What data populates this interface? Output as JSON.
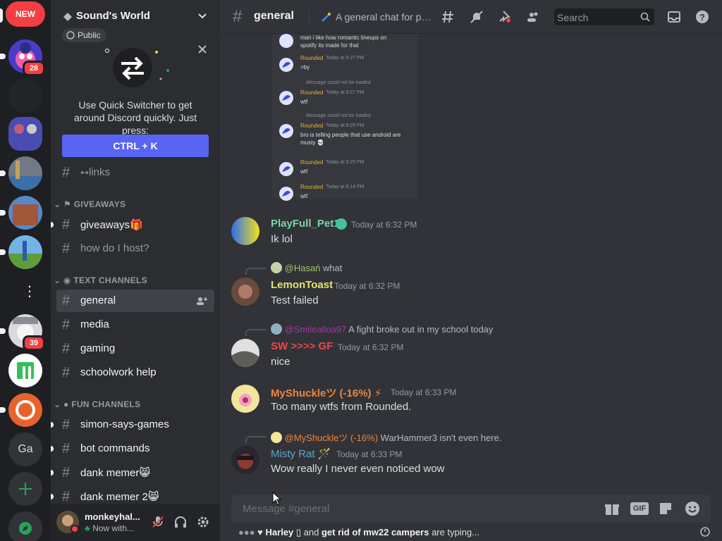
{
  "rail": {
    "new_label": "NEW",
    "badges": {
      "server1": "28",
      "server7": "39"
    },
    "ga_label": "Ga",
    "add_icon": "plus-icon",
    "explore_icon": "compass-icon"
  },
  "server": {
    "name": "Sound's World",
    "public_label": "Public"
  },
  "quick_switcher": {
    "text": "Use Quick Switcher to get around Discord quickly. Just press:",
    "button": "CTRL + K"
  },
  "channels": {
    "links": "⭤links",
    "cat_giveaways": "GIVEAWAYS",
    "giveaways": "giveaways🎁",
    "how_host": "how do I host?",
    "cat_text": "TEXT CHANNELS",
    "general": "general",
    "media": "media",
    "gaming": "gaming",
    "schoolwork": "schoolwork help",
    "cat_fun": "FUN CHANNELS",
    "simon": "simon-says-games",
    "bot": "bot commands",
    "dank1": "dank memer😸",
    "dank2": "dank memer 2😸"
  },
  "user": {
    "name": "monkeyhal...",
    "status": "Now with..."
  },
  "topbar": {
    "channel": "general",
    "topic": "A general chat for peo...",
    "search_placeholder": "Search"
  },
  "embed": [
    {
      "name": "",
      "time": "",
      "text": "man i like how romantic lineups on\nspotify its made for that",
      "reply": ""
    },
    {
      "name": "Rounded",
      "time": "Today at 9:27 PM",
      "text": ">by",
      "reply": ""
    },
    {
      "name": "Rounded",
      "time": "Today at 9:27 PM",
      "text": "wtf",
      "reply": "Message could not be loaded."
    },
    {
      "name": "Rounded",
      "time": "Today at 9:26 PM",
      "text": "bro is telling people that use android are\nmusty 💀",
      "reply": "Message could not be loaded."
    },
    {
      "name": "Rounded",
      "time": "Today at 9:25 PM",
      "text": "wtf",
      "reply": ""
    },
    {
      "name": "Rounded",
      "time": "Today at 9:14 PM",
      "text": "wtf",
      "reply": ""
    }
  ],
  "messages": [
    {
      "name": "PlayFull_Pet1",
      "name_color": "#7dd3a8",
      "time": "Today at 6:32 PM",
      "text": "Ik lol"
    },
    {
      "reply_name": "@Hasań",
      "reply_text": "what",
      "name": "LemonToast",
      "name_color": "#e8e36c",
      "time": "Today at 6:32 PM",
      "text": "Test failed"
    },
    {
      "reply_name": "@Smilealloa97",
      "reply_text": "A fight broke out in my school today",
      "name": "SW >>>> GF",
      "name_color": "#f2444c",
      "time": "Today at 6:32 PM",
      "text": "nice"
    },
    {
      "name": "MyShuckleツ (-16%) ⚡",
      "name_color": "#f0863c",
      "time": "Today at 6:33 PM",
      "text": "Too many wtfs from Rounded."
    },
    {
      "reply_name": "@MyShuckleツ (-16%)",
      "reply_text": "WarHammer3 isn't even here.",
      "name": "Misty Rat 🪄",
      "name_color": "#5aa6c8",
      "time": "Today at 6:33 PM",
      "text": "Wow really I never even noticed wow"
    }
  ],
  "composer": {
    "placeholder": "Message #general",
    "gif_label": "GIF"
  },
  "typing": {
    "user1": "Harley ▯",
    "mid": "and",
    "user2": "get rid of mw22 campers",
    "suffix": "are typing..."
  },
  "colors": {
    "accent": "#5865f2",
    "rail_bg": "#1e1f22",
    "sidebar_bg": "#2b2d31",
    "main_bg": "#313338"
  }
}
